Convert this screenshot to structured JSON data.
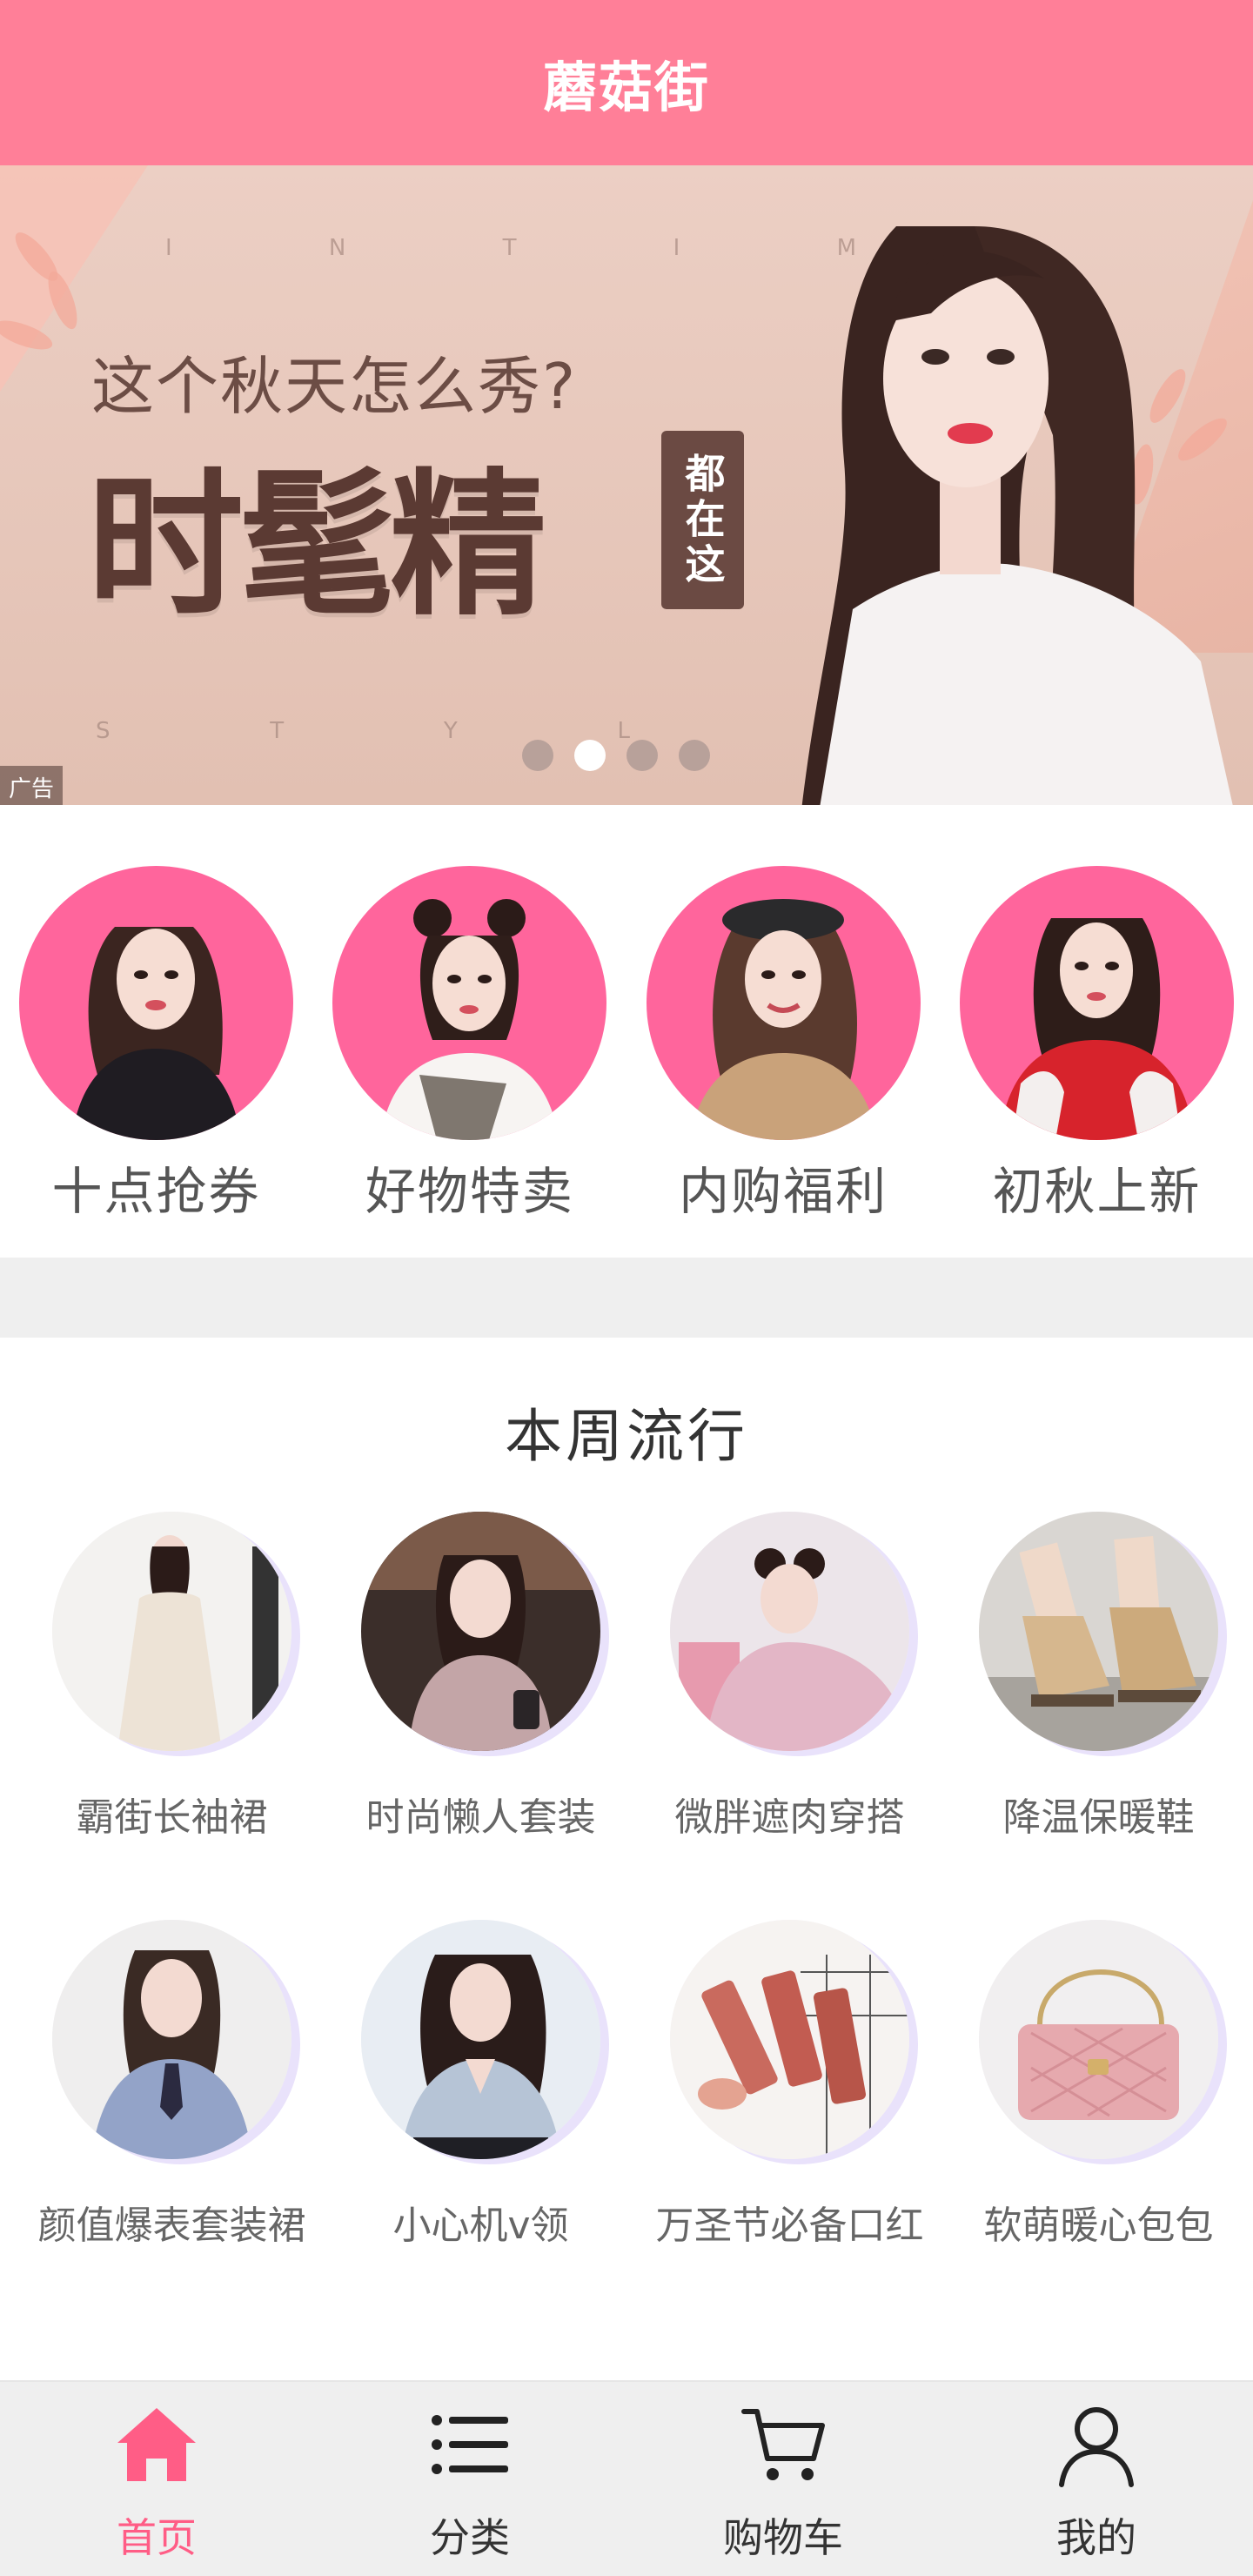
{
  "header": {
    "title": "蘑菇街"
  },
  "banner": {
    "subheading": "这个秋天怎么秀?",
    "headline": "时髦精",
    "vertical_badge": "都在这",
    "background_letters_top": [
      "I",
      "N",
      "T",
      "I",
      "M"
    ],
    "background_letters_bottom": [
      "S",
      "T",
      "Y",
      "L"
    ],
    "ad_tag": "广告",
    "carousel": {
      "count": 4,
      "active_index": 1
    }
  },
  "quick_links": [
    {
      "label": "十点抢券",
      "icon": "model-black-top"
    },
    {
      "label": "好物特卖",
      "icon": "model-plaid"
    },
    {
      "label": "内购福利",
      "icon": "model-beret"
    },
    {
      "label": "初秋上新",
      "icon": "model-red-jacket"
    }
  ],
  "weekly": {
    "title": "本周流行",
    "items": [
      {
        "label": "霸街长袖裙",
        "icon": "cream-dress"
      },
      {
        "label": "时尚懒人套装",
        "icon": "pink-coat"
      },
      {
        "label": "微胖遮肉穿搭",
        "icon": "pink-hoodie"
      },
      {
        "label": "降温保暖鞋",
        "icon": "boots"
      },
      {
        "label": "颜值爆表套装裙",
        "icon": "blue-blouse"
      },
      {
        "label": "小心机v领",
        "icon": "v-neck-top"
      },
      {
        "label": "万圣节必备口红",
        "icon": "lipsticks"
      },
      {
        "label": "软萌暖心包包",
        "icon": "pink-bag"
      }
    ]
  },
  "bottom_nav": {
    "items": [
      {
        "label": "首页",
        "icon": "home-icon",
        "active": true
      },
      {
        "label": "分类",
        "icon": "list-icon",
        "active": false
      },
      {
        "label": "购物车",
        "icon": "cart-icon",
        "active": false
      },
      {
        "label": "我的",
        "icon": "user-icon",
        "active": false
      }
    ]
  },
  "colors": {
    "header_bg": "#ff7f98",
    "accent_pink": "#ff5d86",
    "avatar_pink": "#ff659c",
    "nav_bg": "#efefef",
    "thumb_shadow": "#e9e2fb"
  }
}
